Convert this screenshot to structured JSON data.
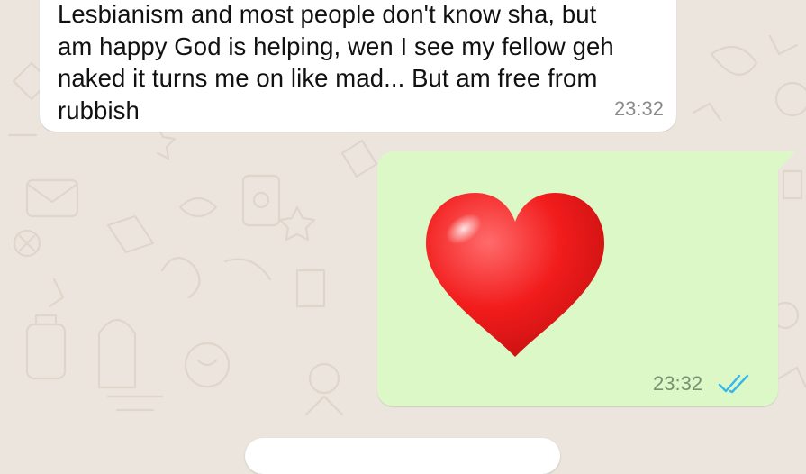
{
  "incoming_message": {
    "text": "Lesbianism and most people don't know sha, but\nam happy God is helping, wen I see my fellow geh\nnaked it turns me on like mad... But am free from\nrubbish",
    "time": "23:32"
  },
  "outgoing_message": {
    "emoji": "heart-emoji",
    "time": "23:32",
    "status": "read",
    "status_color": "#34b7f1"
  },
  "colors": {
    "wallpaper": "#ece5dd",
    "incoming_bubble": "#ffffff",
    "outgoing_bubble": "#dcf8c6"
  }
}
